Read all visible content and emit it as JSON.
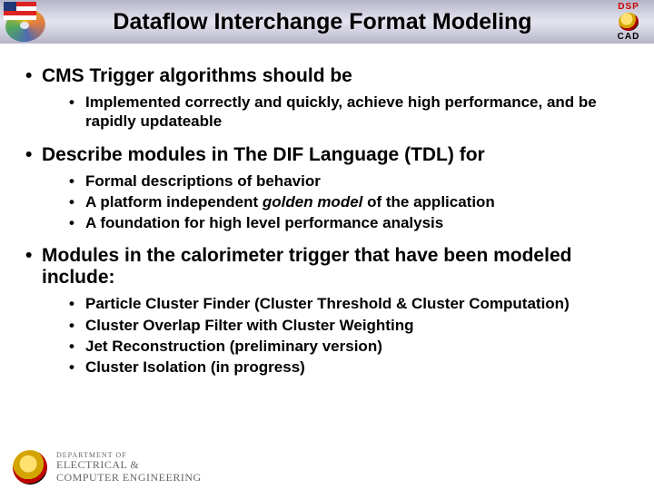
{
  "header": {
    "title": "Dataflow Interchange Format Modeling",
    "badge_right_top": "DSP",
    "badge_right_bottom": "CAD"
  },
  "bullets": [
    {
      "text": "CMS Trigger algorithms should be",
      "sub": [
        {
          "text": "Implemented correctly and quickly, achieve high performance, and be rapidly updateable"
        }
      ]
    },
    {
      "text": "Describe modules in The DIF Language (TDL) for",
      "sub": [
        {
          "text": "Formal descriptions of behavior"
        },
        {
          "html": "A platform independent <span class=\"ital\">golden model</span> of the application"
        },
        {
          "text": "A foundation for high level performance analysis"
        }
      ]
    },
    {
      "text": "Modules in the calorimeter trigger that have been modeled include:",
      "sub": [
        {
          "text": "Particle Cluster Finder (Cluster Threshold & Cluster Computation)"
        },
        {
          "text": "Cluster Overlap Filter with Cluster Weighting"
        },
        {
          "text": "Jet Reconstruction (preliminary version)"
        },
        {
          "text": "Cluster Isolation (in progress)"
        }
      ]
    }
  ],
  "footer": {
    "line1": "DEPARTMENT OF",
    "line2": "ELECTRICAL",
    "amp": "&",
    "line3": "COMPUTER ENGINEERING"
  }
}
